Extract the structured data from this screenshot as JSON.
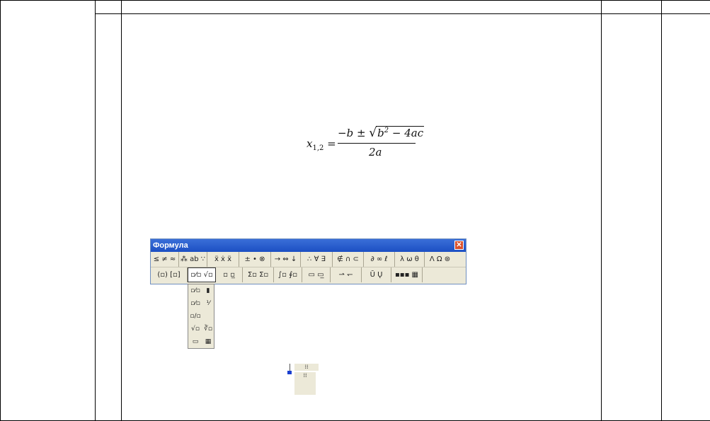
{
  "formula": {
    "lhs_var": "x",
    "lhs_sub": "1,2",
    "equals": "=",
    "num_pre": "−b ± ",
    "sqrt_sym": "√",
    "rad_b": "b",
    "rad_exp": "2",
    "rad_rest": " − 4ac",
    "den": "2a"
  },
  "toolbar": {
    "title": "Формула",
    "close": "✕",
    "row1": [
      {
        "name": "relations-group",
        "label": "≤ ≠ ≈"
      },
      {
        "name": "spaces-group",
        "label": "⁂ ab ∵"
      },
      {
        "name": "embellishments-group",
        "label": "ẍ ẋ ẍ"
      },
      {
        "name": "operators-group",
        "label": "± • ⊗"
      },
      {
        "name": "arrows-group",
        "label": "→ ⇔ ↓"
      },
      {
        "name": "logic-group",
        "label": "∴ ∀ ∃"
      },
      {
        "name": "sets-group",
        "label": "∉ ∩ ⊂"
      },
      {
        "name": "misc-group",
        "label": "∂ ∞ ℓ"
      },
      {
        "name": "greek-lower-group",
        "label": "λ ω θ"
      },
      {
        "name": "greek-upper-group",
        "label": "Λ Ω ⊛"
      }
    ],
    "row2": [
      {
        "name": "fences-template",
        "label": "(▫) [▫]"
      },
      {
        "name": "fraction-radical-template",
        "label": "▫⁄▫ √▫"
      },
      {
        "name": "subscript-template",
        "label": "▫ ▫̲"
      },
      {
        "name": "summation-template",
        "label": "Σ▫ Σ▫"
      },
      {
        "name": "integral-template",
        "label": "∫▫ ∮▫"
      },
      {
        "name": "underbar-template",
        "label": "▭ ▭̲"
      },
      {
        "name": "labeled-arrow-template",
        "label": "⇀ ↽"
      },
      {
        "name": "products-template",
        "label": "Ū Ų"
      },
      {
        "name": "matrix-template",
        "label": "▪▪▪ ▦"
      }
    ]
  },
  "palette": {
    "cells": [
      "▫⁄▫",
      "▮",
      "▫⁄▫",
      "⅟",
      "▫/▫",
      "",
      "√▫",
      "∛▫",
      "▭",
      "▦"
    ]
  },
  "fragment": {
    "top": "⁞⁞",
    "bottom": "⁞⁞"
  }
}
